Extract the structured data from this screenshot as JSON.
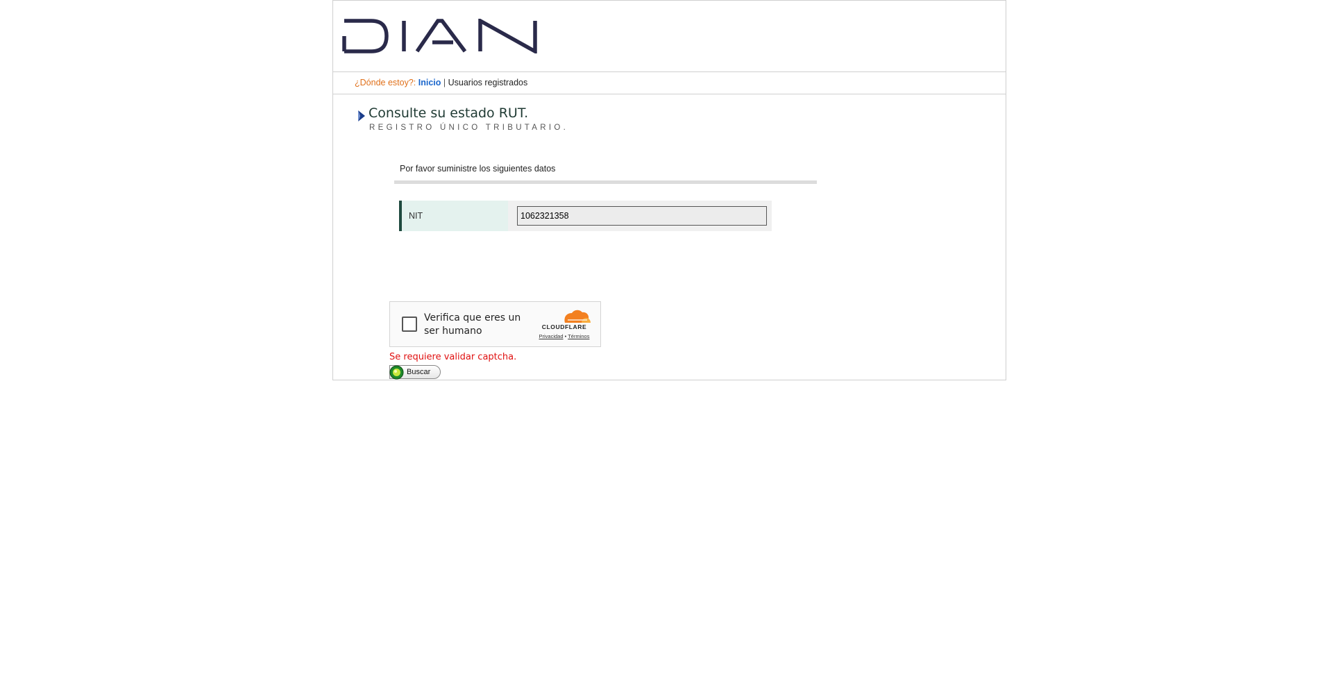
{
  "header": {
    "logo_text": "DIAN"
  },
  "breadcrumb": {
    "where_label": "¿Dónde estoy?:",
    "home_link": "Inicio",
    "separator": "|",
    "current": "Usuarios registrados"
  },
  "page": {
    "title": "Consulte su estado RUT.",
    "subtitle": "REGISTRO ÚNICO TRIBUTARIO."
  },
  "form": {
    "instructions": "Por favor suministre los siguientes datos",
    "nit_label": "NIT",
    "nit_value": "1062321358"
  },
  "captcha": {
    "label": "Verifica que eres un ser humano",
    "brand": "CLOUDFLARE",
    "privacy_link": "Privacidad",
    "link_separator": "•",
    "terms_link": "Términos",
    "error": "Se requiere validar captcha."
  },
  "actions": {
    "search_label": "Buscar"
  },
  "colors": {
    "logo": "#2a2a4a",
    "breadcrumb_where": "#e0701a",
    "breadcrumb_link": "#1a66cc",
    "error": "#e01010",
    "nit_label_bg": "#e4f2ee",
    "nit_label_border": "#1f4a3f",
    "cloudflare_orange": "#f38020"
  },
  "icons": {
    "title_arrow": "arrow-right-icon",
    "cloudflare": "cloud-icon",
    "search_button": "green-circle-icon"
  }
}
